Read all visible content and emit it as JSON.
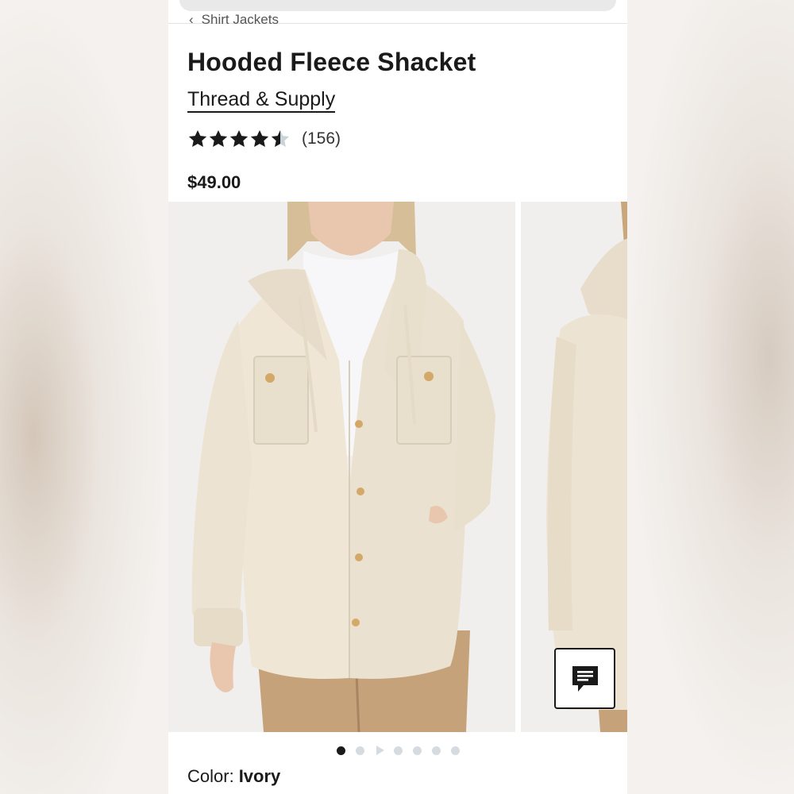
{
  "breadcrumb": {
    "label": "Shirt Jackets"
  },
  "product": {
    "title": "Hooded Fleece Shacket",
    "brand": "Thread & Supply",
    "rating_stars": 4.5,
    "review_count": "(156)",
    "price": "$49.00"
  },
  "gallery": {
    "image_count": 7,
    "active_index": 0,
    "dot_types": [
      "image",
      "image",
      "video",
      "image",
      "image",
      "image",
      "image"
    ]
  },
  "color": {
    "label": "Color:",
    "value": "Ivory"
  },
  "icons": {
    "back": "chevron-left-icon",
    "star": "star-icon",
    "chat": "chat-icon",
    "video": "play-icon"
  },
  "colors": {
    "star_filled": "#1a1a1a",
    "star_empty": "#c9d3da",
    "jacket": "#efe6d6",
    "dot_inactive": "#d5dbe0"
  }
}
